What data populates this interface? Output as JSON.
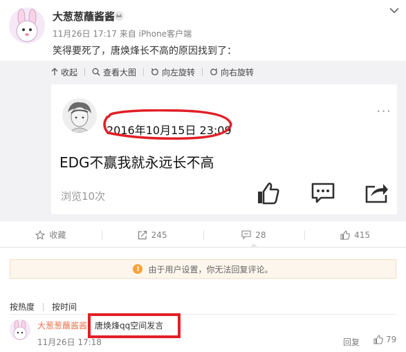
{
  "post": {
    "author": "大葱葱蘸酱酱",
    "time": "11月26日 17:17",
    "source_prefix": "来自",
    "source": "iPhone客户端",
    "text": "笑得要死了，唐焕烽长不高的原因找到了："
  },
  "media_toolbar": {
    "collapse": "收起",
    "view_large": "查看大图",
    "rotate_left": "向左旋转",
    "rotate_right": "向右旋转"
  },
  "screenshot": {
    "date": "2016年10月15日 23:09",
    "text": "EDG不赢我就永远长不高",
    "views": "浏览10次"
  },
  "actions": {
    "favorite": "收藏",
    "repost": "245",
    "comment": "28",
    "like": "415"
  },
  "notice": "由于用户设置，你无法回复评论。",
  "sort": {
    "by_hot": "按热度",
    "by_time": "按时间"
  },
  "comment": {
    "author": "大葱葱蘸酱酱",
    "text": "唐焕烽qq空间发言",
    "time": "11月26日 17:18",
    "reply": "回复",
    "likes": "79"
  },
  "colors": {
    "accent_orange": "#eb7350",
    "highlight_red": "#e21f26",
    "warning": "#f7a23c"
  }
}
